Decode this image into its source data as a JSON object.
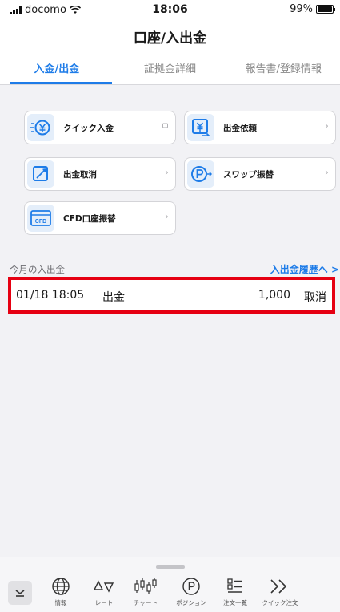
{
  "status_bar": {
    "carrier": "docomo",
    "time": "18:06",
    "battery": "99%"
  },
  "header": {
    "title": "口座/入出金",
    "tabs": [
      {
        "label": "入金/出金",
        "active": true
      },
      {
        "label": "証拠金詳細",
        "active": false
      },
      {
        "label": "報告書/登録情報",
        "active": false
      }
    ]
  },
  "actions": [
    {
      "label": "クイック入金",
      "icon": "yen-coin-icon",
      "chevron": "external-link-icon"
    },
    {
      "label": "出金依頼",
      "icon": "yen-withdraw-icon",
      "chevron": "chevron-right-icon"
    },
    {
      "label": "出金取消",
      "icon": "cancel-edit-icon",
      "chevron": "chevron-right-icon"
    },
    {
      "label": "スワップ振替",
      "icon": "swap-p-icon",
      "chevron": "chevron-right-icon"
    },
    {
      "label": "CFD口座振替",
      "icon": "cfd-card-icon",
      "chevron": "chevron-right-icon"
    }
  ],
  "monthly": {
    "section_label": "今月の入出金",
    "history_link": "入出金履歴へ >",
    "rows": [
      {
        "datetime": "01/18 18:05",
        "type": "出金",
        "amount": "1,000",
        "action": "取消"
      }
    ]
  },
  "bottom_nav": {
    "items": [
      {
        "label": "情報",
        "icon": "globe-icon"
      },
      {
        "label": "レート",
        "icon": "rate-triangles-icon"
      },
      {
        "label": "チャート",
        "icon": "candlestick-icon"
      },
      {
        "label": "ポジション",
        "icon": "position-p-icon"
      },
      {
        "label": "注文一覧",
        "icon": "order-list-icon"
      },
      {
        "label": "クイック注文",
        "icon": "double-chevron-icon"
      }
    ]
  },
  "colors": {
    "accent": "#1e7ce8",
    "highlight_border": "#e60012",
    "icon_bg": "#e4eefa"
  }
}
